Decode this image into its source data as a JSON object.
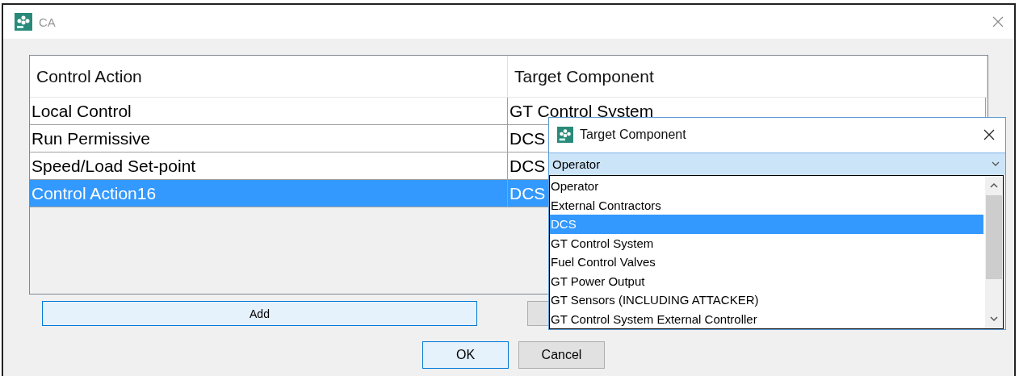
{
  "window": {
    "title": "CA"
  },
  "table": {
    "columns": [
      "Control Action",
      "Target Component"
    ],
    "rows": [
      {
        "cells": [
          "Local Control",
          "GT Control System"
        ],
        "selected": false
      },
      {
        "cells": [
          "Run Permissive",
          "DCS"
        ],
        "selected": false
      },
      {
        "cells": [
          "Speed/Load Set-point",
          "DCS"
        ],
        "selected": false
      },
      {
        "cells": [
          "Control Action16",
          "DCS"
        ],
        "selected": true
      }
    ]
  },
  "add_button": "Add",
  "buttons": [
    {
      "label": "OK",
      "default": true
    },
    {
      "label": "Cancel",
      "default": false
    }
  ],
  "popup": {
    "title": "Target Component",
    "combo_value": "Operator",
    "options": [
      {
        "label": "Operator",
        "selected": false
      },
      {
        "label": "External Contractors",
        "selected": false
      },
      {
        "label": "DCS",
        "selected": true
      },
      {
        "label": "GT Control System",
        "selected": false
      },
      {
        "label": "Fuel Control Valves",
        "selected": false
      },
      {
        "label": "GT Power Output",
        "selected": false
      },
      {
        "label": "GT Sensors (INCLUDING ATTACKER)",
        "selected": false
      },
      {
        "label": "GT Control System External Controller",
        "selected": false
      }
    ]
  }
}
